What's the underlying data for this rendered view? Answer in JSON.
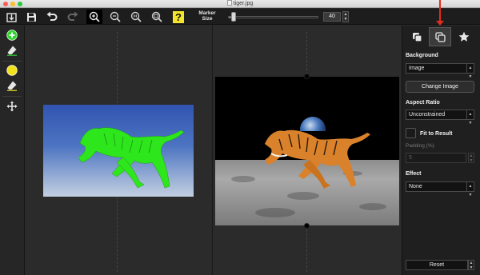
{
  "window": {
    "title": "tiger.jpg"
  },
  "toolbar": {
    "marker_label": "Marker\nSize",
    "marker_size": "40",
    "marker_fraction": 0.05,
    "help_label": "?"
  },
  "sidebar": {
    "background_label": "Background",
    "background_value": "Image",
    "change_image_label": "Change Image",
    "aspect_ratio_label": "Aspect Ratio",
    "aspect_ratio_value": "Unconstrained",
    "fit_to_result_label": "Fit to Result",
    "padding_label": "Padding (%)",
    "padding_value": "5",
    "effect_label": "Effect",
    "effect_value": "None",
    "reset_label": "Reset"
  },
  "colors": {
    "foreground_marker": "#2bd62b",
    "background_marker": "#f2e21e",
    "annotation_arrow": "#e52b1a"
  }
}
